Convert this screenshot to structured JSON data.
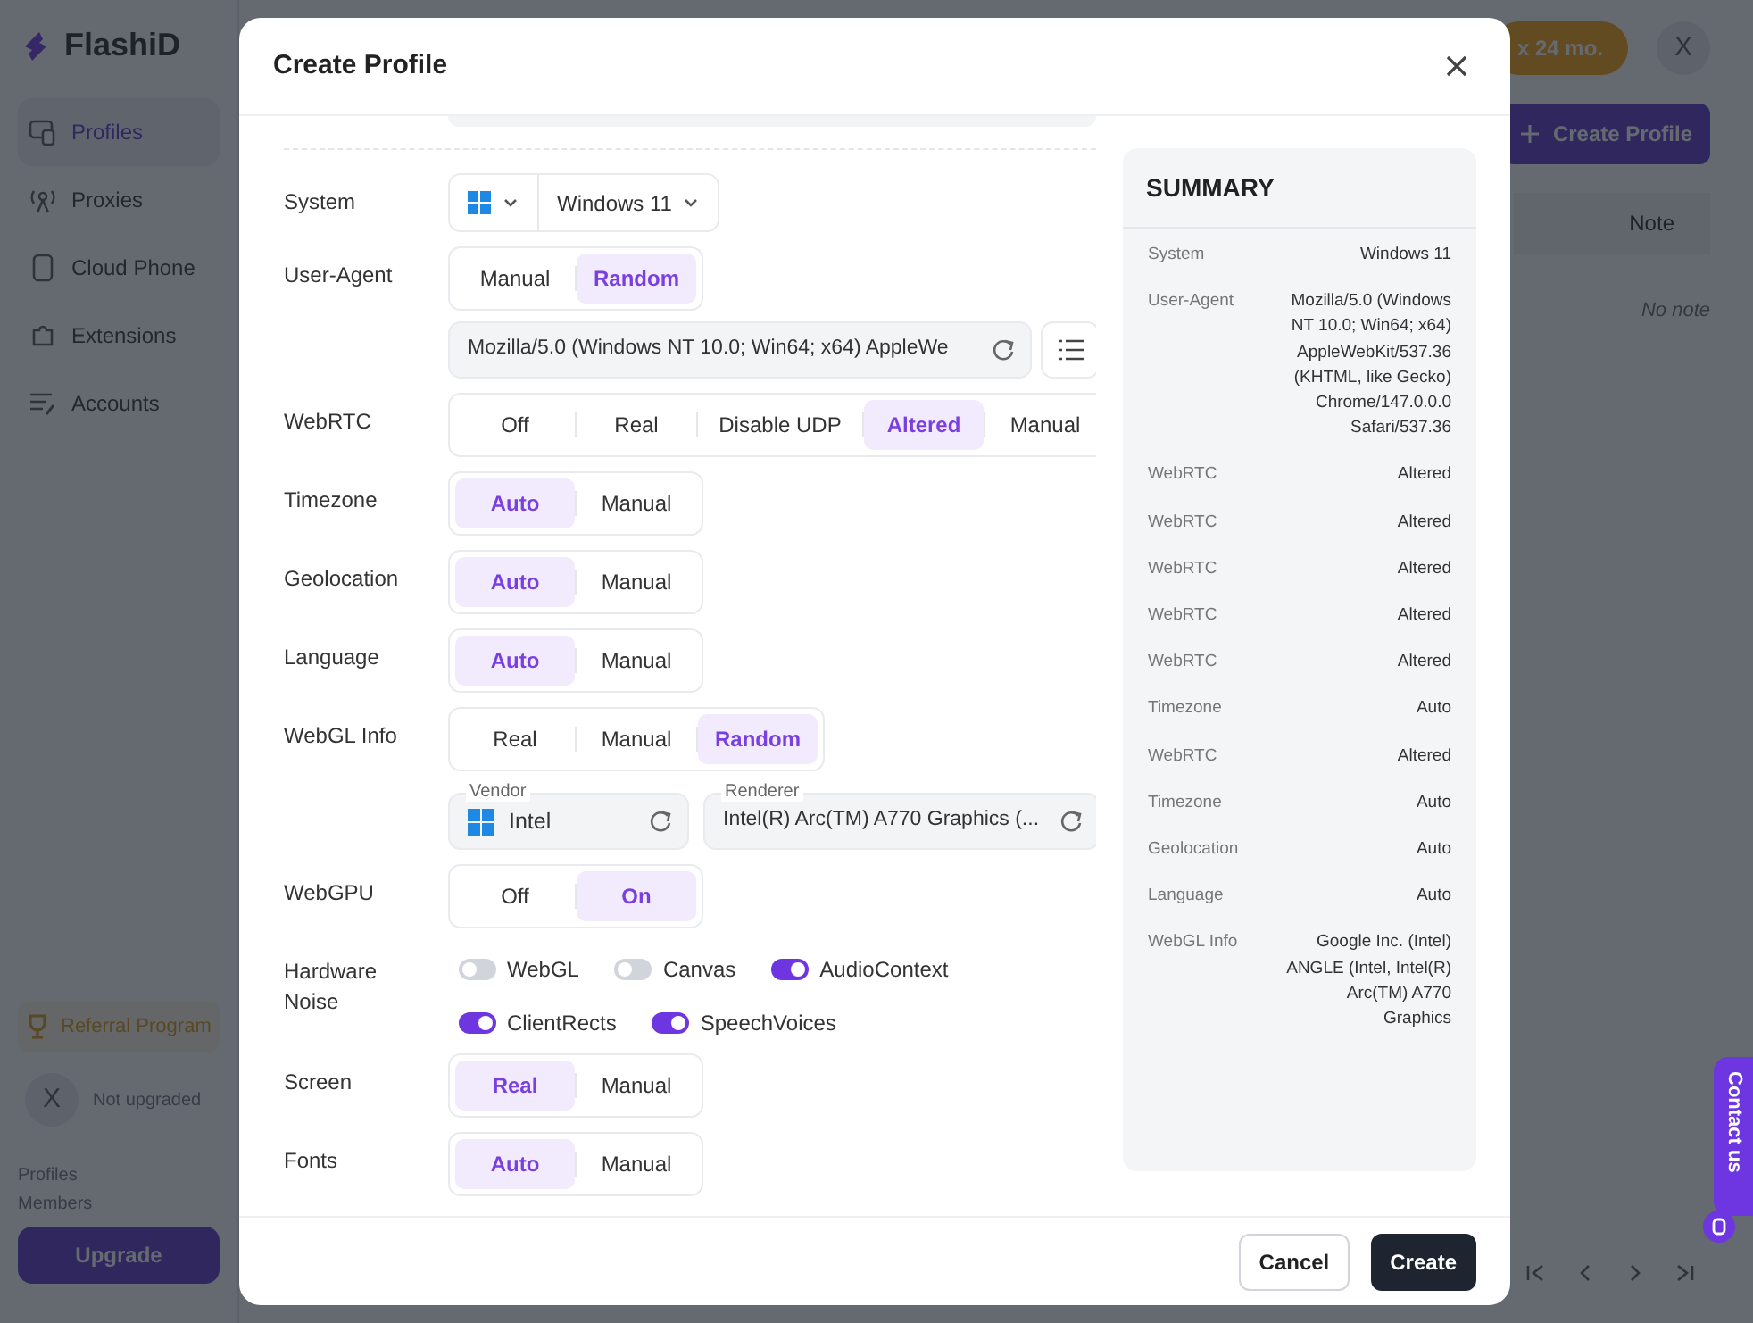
{
  "app": {
    "logo": "FlashiD",
    "nav": [
      {
        "label": "Profiles",
        "selected": true
      },
      {
        "label": "Proxies",
        "selected": false
      },
      {
        "label": "Cloud Phone",
        "selected": false
      },
      {
        "label": "Extensions",
        "selected": false
      },
      {
        "label": "Accounts",
        "selected": false
      }
    ],
    "referral": "Referral Program",
    "user": {
      "avatar": "X",
      "status": "Not upgraded"
    },
    "plan_stats": [
      "Profiles",
      "Members"
    ],
    "upgrade": "Upgrade",
    "promo": "x 24 mo.",
    "account_avatar": "X",
    "create_profile": "Create Profile",
    "table": {
      "columns": [
        "Note"
      ],
      "rows": [
        {
          "note": "No note"
        }
      ]
    },
    "contact": "Contact us"
  },
  "modal": {
    "title": "Create Profile",
    "fields": [
      {
        "kind": "select",
        "label": "System",
        "value": "Windows 11"
      },
      {
        "kind": "segmented",
        "label": "User-Agent",
        "options": [
          {
            "label": "Manual",
            "selected": false
          },
          {
            "label": "Random",
            "selected": true
          }
        ],
        "input": {
          "value": "Mozilla/5.0 (Windows NT 10.0; Win64; x64) AppleWe"
        }
      },
      {
        "kind": "segmented",
        "label": "WebRTC",
        "options": [
          {
            "label": "Off",
            "selected": false
          },
          {
            "label": "Real",
            "selected": false
          },
          {
            "label": "Disable UDP",
            "selected": false
          },
          {
            "label": "Altered",
            "selected": true
          },
          {
            "label": "Manual",
            "selected": false
          }
        ]
      },
      {
        "kind": "segmented",
        "label": "Timezone",
        "options": [
          {
            "label": "Auto",
            "selected": true
          },
          {
            "label": "Manual",
            "selected": false
          }
        ]
      },
      {
        "kind": "segmented",
        "label": "Geolocation",
        "options": [
          {
            "label": "Auto",
            "selected": true
          },
          {
            "label": "Manual",
            "selected": false
          }
        ]
      },
      {
        "kind": "segmented",
        "label": "Language",
        "options": [
          {
            "label": "Auto",
            "selected": true
          },
          {
            "label": "Manual",
            "selected": false
          }
        ]
      },
      {
        "kind": "segmented",
        "label": "WebGL Info",
        "options": [
          {
            "label": "Real",
            "selected": false
          },
          {
            "label": "Manual",
            "selected": false
          },
          {
            "label": "Random",
            "selected": true
          }
        ],
        "vendor": {
          "label": "Vendor",
          "value": "Intel"
        },
        "renderer": {
          "label": "Renderer",
          "value": "Intel(R) Arc(TM) A770 Graphics (..."
        }
      },
      {
        "kind": "segmented",
        "label": "WebGPU",
        "options": [
          {
            "label": "Off",
            "selected": false
          },
          {
            "label": "On",
            "selected": true
          }
        ]
      },
      {
        "kind": "toggles",
        "label": "Hardware Noise",
        "items": [
          {
            "label": "WebGL",
            "on": false
          },
          {
            "label": "Canvas",
            "on": false
          },
          {
            "label": "AudioContext",
            "on": true
          },
          {
            "label": "ClientRects",
            "on": true
          },
          {
            "label": "SpeechVoices",
            "on": true
          }
        ]
      },
      {
        "kind": "segmented",
        "label": "Screen",
        "options": [
          {
            "label": "Real",
            "selected": true
          },
          {
            "label": "Manual",
            "selected": false
          }
        ]
      },
      {
        "kind": "segmented",
        "label": "Fonts",
        "options": [
          {
            "label": "Auto",
            "selected": true
          },
          {
            "label": "Manual",
            "selected": false
          }
        ]
      }
    ],
    "summary": {
      "title": "SUMMARY",
      "rows": [
        {
          "label": "System",
          "value": "Windows 11"
        },
        {
          "label": "User-Agent",
          "value": "Mozilla/5.0 (Windows NT 10.0; Win64; x64) AppleWebKit/537.36 (KHTML, like Gecko) Chrome/147.0.0.0 Safari/537.36"
        },
        {
          "label": "WebRTC",
          "value": "Altered"
        },
        {
          "label": "WebRTC",
          "value": "Altered"
        },
        {
          "label": "WebRTC",
          "value": "Altered"
        },
        {
          "label": "WebRTC",
          "value": "Altered"
        },
        {
          "label": "WebRTC",
          "value": "Altered"
        },
        {
          "label": "Timezone",
          "value": "Auto"
        },
        {
          "label": "WebRTC",
          "value": "Altered"
        },
        {
          "label": "Timezone",
          "value": "Auto"
        },
        {
          "label": "Geolocation",
          "value": "Auto"
        },
        {
          "label": "Language",
          "value": "Auto"
        },
        {
          "label": "WebGL Info",
          "value": "Google Inc. (Intel) ANGLE (Intel, Intel(R) Arc(TM) A770 Graphics"
        }
      ]
    },
    "buttons": [
      {
        "label": "Cancel",
        "kind": "secondary"
      },
      {
        "label": "Create",
        "kind": "primary"
      }
    ]
  }
}
